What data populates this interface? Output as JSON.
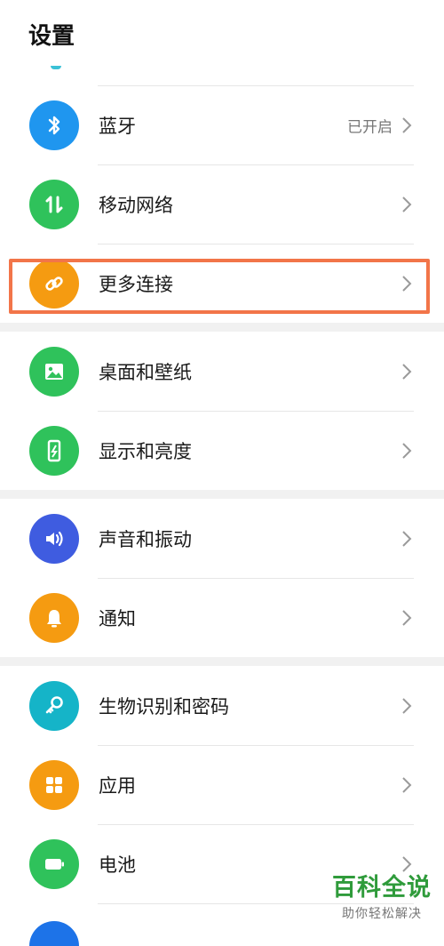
{
  "header": {
    "title": "设置"
  },
  "rows": {
    "bluetooth": {
      "label": "蓝牙",
      "value": "已开启",
      "color": "#1f96ef",
      "icon": "bluetooth-icon"
    },
    "mobile_network": {
      "label": "移动网络",
      "color": "#2fc25b",
      "icon": "mobile-data-arrows-icon"
    },
    "more_connections": {
      "label": "更多连接",
      "color": "#f59b11",
      "icon": "link-icon",
      "highlight_color": "#f27549"
    },
    "wallpaper": {
      "label": "桌面和壁纸",
      "color": "#2fc25b",
      "icon": "image-icon"
    },
    "display": {
      "label": "显示和亮度",
      "color": "#2fc25b",
      "icon": "phone-brightness-icon"
    },
    "sound": {
      "label": "声音和振动",
      "color": "#3f5ce0",
      "icon": "speaker-icon"
    },
    "notifications": {
      "label": "通知",
      "color": "#f59b11",
      "icon": "bell-icon"
    },
    "biometrics": {
      "label": "生物识别和密码",
      "color": "#15b4c8",
      "icon": "key-icon"
    },
    "apps": {
      "label": "应用",
      "color": "#f59b11",
      "icon": "apps-grid-icon"
    },
    "battery": {
      "label": "电池",
      "color": "#2fc25b",
      "icon": "battery-icon"
    }
  },
  "watermark": {
    "title": "百科全说",
    "subtitle": "助你轻松解决"
  }
}
